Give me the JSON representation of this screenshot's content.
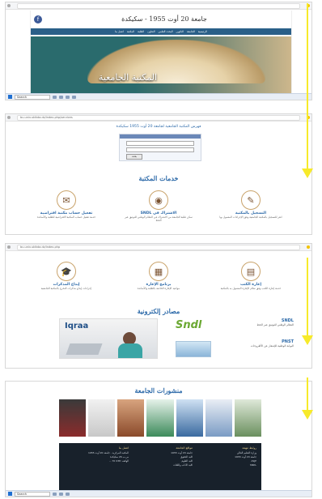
{
  "shot1": {
    "university_name": "جامعة 20 أوت 1955 - سكيكدة",
    "nav_items": [
      "الرئيسية",
      "الجامعة",
      "التكوين",
      "البحث العلمي",
      "التعاون",
      "الطلبة",
      "المكتبة",
      "اتصل بنا"
    ],
    "banner_title": "المكتبة الجامعية",
    "taskbar_search": "Search"
  },
  "shot2": {
    "address_bar": "bu.univ-skikda.dz/index.php/services",
    "opac_title": "فهرس المكتبة الجامعية لجامعة 20 أوت 1955 سكيكدة",
    "search_button": "بحث",
    "services_title": "خدمات المكتبة",
    "services": [
      {
        "icon": "✎",
        "name": "التسجيل بالمكتبة",
        "text": "انقر للتسجيل بالمكتبة الجامعية وفق الإجراءات المعمول بها"
      },
      {
        "icon": "◉",
        "name": "الاشتراك في SNDL",
        "text": "تمكن طلبة الجامعة من الاشتراك في النظام الوطني للتوثيق عبر الخط"
      },
      {
        "icon": "✉",
        "name": "تفعيل حساب مكتبة افتراضية",
        "text": "خدمة تفعيل حساب المكتبة الافتراضية للطلبة والأساتذة"
      }
    ]
  },
  "shot3": {
    "address_bar": "bu.univ-skikda.dz/index.php",
    "services": [
      {
        "icon": "▤",
        "name": "إعارة الكتب",
        "text": "خدمة إعارة الكتب وفق نظام الإعارة المعمول به بالمكتبة"
      },
      {
        "icon": "▦",
        "name": "برنامج الإعارة",
        "text": "مواعيد الإعارة الخاصة بالطلبة والأساتذة"
      },
      {
        "icon": "🎓",
        "name": "إيداع المذكرات",
        "text": "إجراءات إيداع مذكرات التخرج بالمكتبة الجامعية"
      }
    ],
    "eresources_title": "مصادر إلكترونية",
    "resources": [
      {
        "name": "SNDL",
        "text": "النظام الوطني للتوثيق عبر الخط"
      },
      {
        "name": "PNST",
        "text": "البوابة الوطنية للإشعار عن الأطروحات"
      }
    ],
    "logo_iqraa": "Iqraa",
    "logo_sndl": "Sndl"
  },
  "shot4": {
    "publications_title": "منشورات الجامعة",
    "footer_cols": [
      {
        "title": "روابط مهمة",
        "lines": [
          "وزارة التعليم العالي",
          "جامعة 20 أوت 1955",
          "ASJP",
          "SNDL"
        ]
      },
      {
        "title": "مواقع الجامعة",
        "lines": [
          "جامعة 20 أوت 1955",
          "كلية الحقوق",
          "كلية العلوم",
          "كلية الآداب واللغات"
        ]
      },
      {
        "title": "اتصل بنا",
        "lines": [
          "المكتبة المركزية - جامعة 20 أوت 1955",
          "ص.ب 26 سكيكدة",
          "الهاتف: 038 70 ..."
        ]
      }
    ],
    "taskbar_search": "Search"
  },
  "colors": {
    "accent_blue": "#2d6aa9",
    "banner_teal": "#2a6b6d",
    "footer_dark": "#18212b",
    "arrow_yellow": "#f7ea2a"
  }
}
